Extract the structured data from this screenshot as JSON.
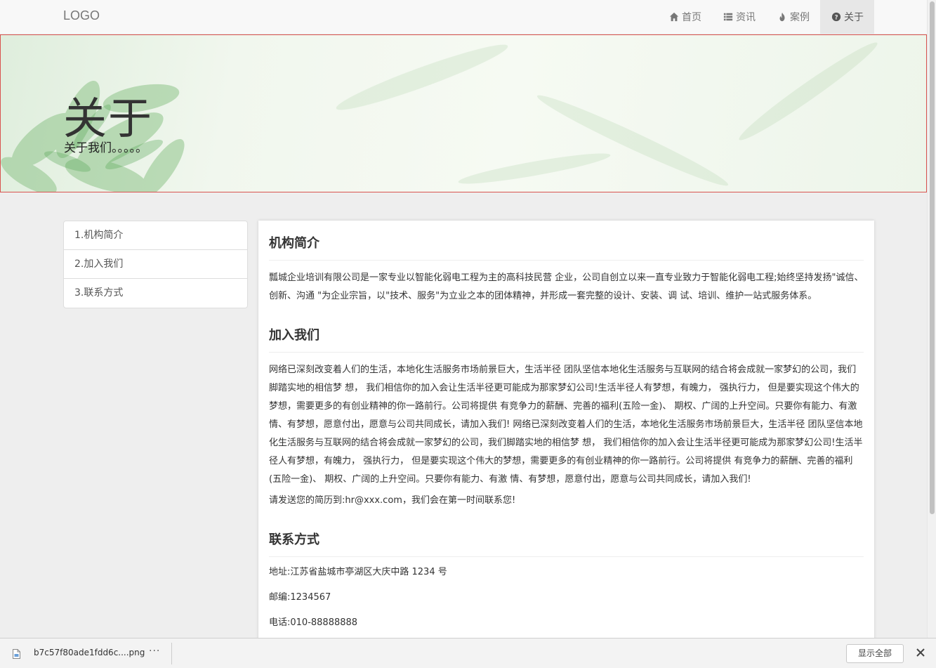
{
  "navbar": {
    "logo": "LOGO",
    "items": [
      {
        "label": "首页",
        "icon": "home-icon"
      },
      {
        "label": "资讯",
        "icon": "list-icon"
      },
      {
        "label": "案例",
        "icon": "fire-icon"
      },
      {
        "label": "关于",
        "icon": "question-circle-icon",
        "active": true
      }
    ]
  },
  "banner": {
    "title": "关于",
    "subtitle": "关于我们。。。。。"
  },
  "sidebar": {
    "items": [
      {
        "label": "1.机构简介"
      },
      {
        "label": "2.加入我们"
      },
      {
        "label": "3.联系方式"
      }
    ]
  },
  "main": {
    "intro": {
      "heading": "机构简介",
      "text": "瓢城企业培训有限公司是一家专业以智能化弱电工程为主的高科技民营 企业，公司自创立以来一直专业致力于智能化弱电工程;始终坚持发扬\"诚信、创新、沟通 \"为企业宗旨，以\"技术、服务\"为立业之本的团体精神，并形成一套完整的设计、安装、调 试、培训、维护一站式服务体系。"
    },
    "join": {
      "heading": "加入我们",
      "text": "网络已深刻改变着人们的生活，本地化生活服务市场前景巨大，生活半径 团队坚信本地化生活服务与互联网的结合将会成就一家梦幻的公司，我们脚踏实地的相信梦 想， 我们相信你的加入会让生活半径更可能成为那家梦幻公司!生活半径人有梦想，有魄力， 强执行力， 但是要实现这个伟大的梦想，需要更多的有创业精神的你一路前行。公司将提供 有竞争力的薪酬、完善的福利(五险一金)、 期权、广阔的上升空间。只要你有能力、有激 情、有梦想，愿意付出，愿意与公司共同成长，请加入我们! 网络已深刻改变着人们的生活，本地化生活服务市场前景巨大，生活半径 团队坚信本地化生活服务与互联网的结合将会成就一家梦幻的公司，我们脚踏实地的相信梦 想， 我们相信你的加入会让生活半径更可能成为那家梦幻公司!生活半径人有梦想，有魄力， 强执行力， 但是要实现这个伟大的梦想，需要更多的有创业精神的你一路前行。公司将提供 有竞争力的薪酬、完善的福利(五险一金)、 期权、广阔的上升空间。只要你有能力、有激 情、有梦想，愿意付出，愿意与公司共同成长，请加入我们!",
      "resume": "请发送您的简历到:hr@xxx.com，我们会在第一时间联系您!"
    },
    "contact": {
      "heading": "联系方式",
      "address": "地址:江苏省盐城市亭湖区大庆中路 1234 号",
      "postcode": "邮编:1234567",
      "phone": "电话:010-88888888"
    }
  },
  "download_bar": {
    "filename": "b7c57f80ade1fdd6c....png",
    "more": "···",
    "show_all": "显示全部"
  }
}
